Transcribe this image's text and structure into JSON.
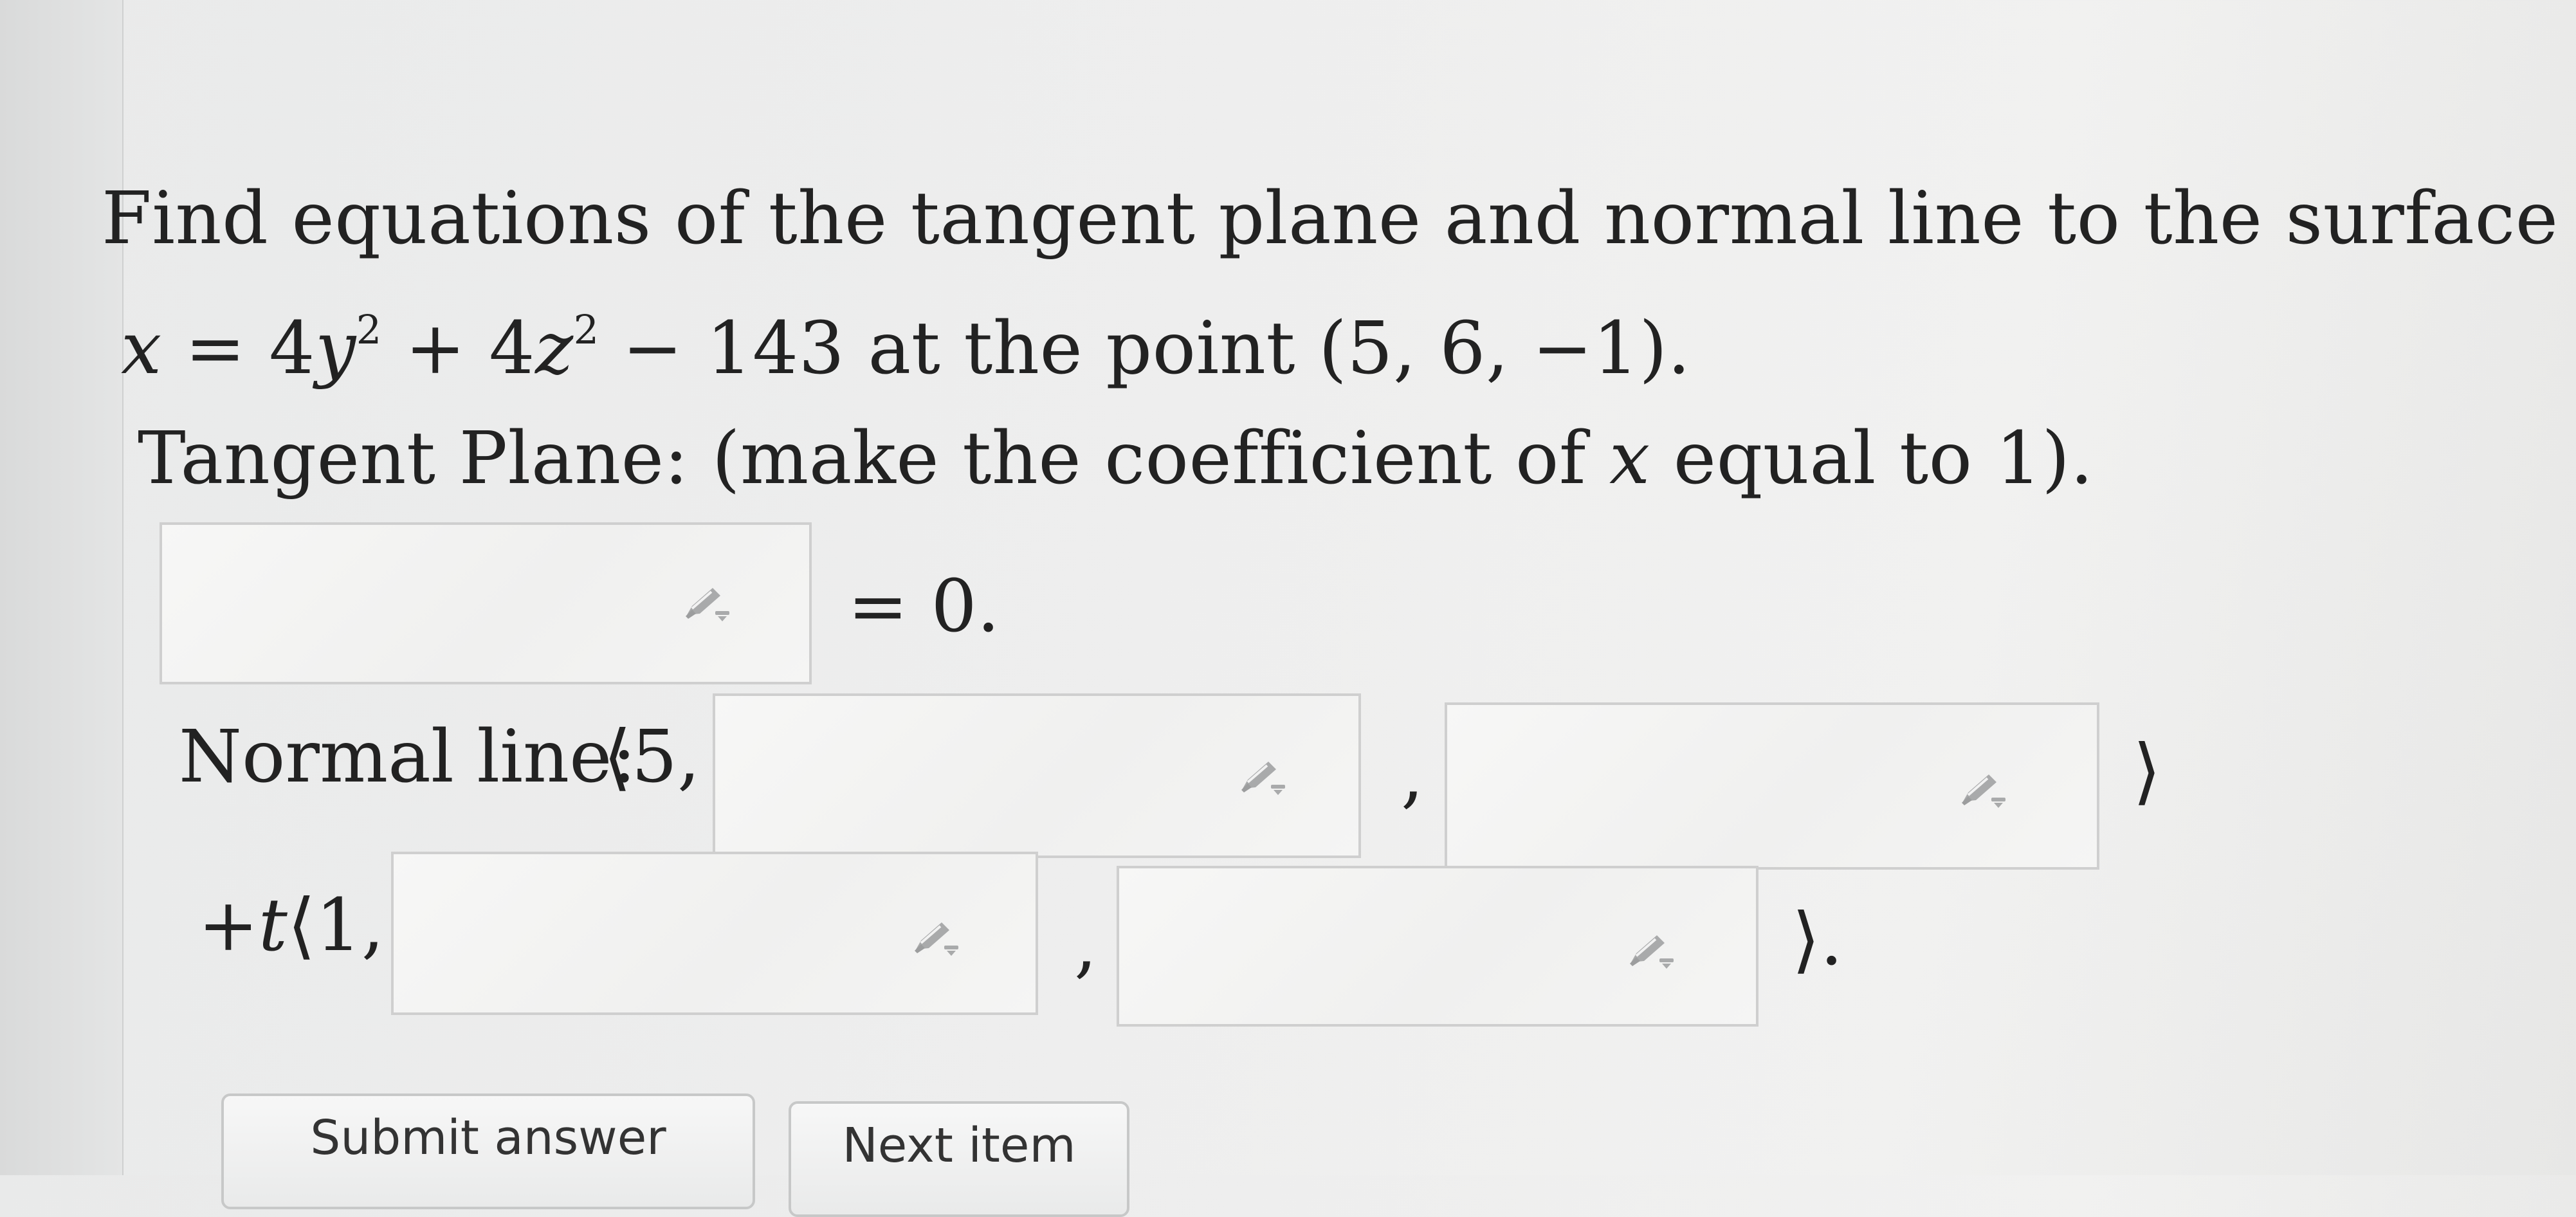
{
  "question": {
    "line1": "Find equations of the tangent plane and normal line to the surface",
    "line2": {
      "var_x": "x",
      "eq": "=",
      "c1": "4",
      "var_y": "y",
      "exp1": "2",
      "plus": "+",
      "c2": "4",
      "var_z": "z",
      "exp2": "2",
      "minus": "−",
      "c3": "143",
      "text": "at the point",
      "point": "(5, 6, −1)."
    },
    "line3": {
      "before": "Tangent Plane: (make the coefficient of",
      "var_x": "x",
      "after": "equal to 1)."
    }
  },
  "tangent_plane": {
    "equals_text": "= 0."
  },
  "normal_line": {
    "label": "Normal line:",
    "open": "⟨5,",
    "comma": ",",
    "close": "⟩",
    "row2_plus": "+",
    "row2_t": "t",
    "row2_open": "⟨1,",
    "row2_comma": ",",
    "row2_close": "⟩."
  },
  "buttons": {
    "submit": "Submit answer",
    "next": "Next item"
  },
  "icons": {
    "field_icon": "pencil-dropdown-icon",
    "icon_color": "#a9aaab"
  }
}
